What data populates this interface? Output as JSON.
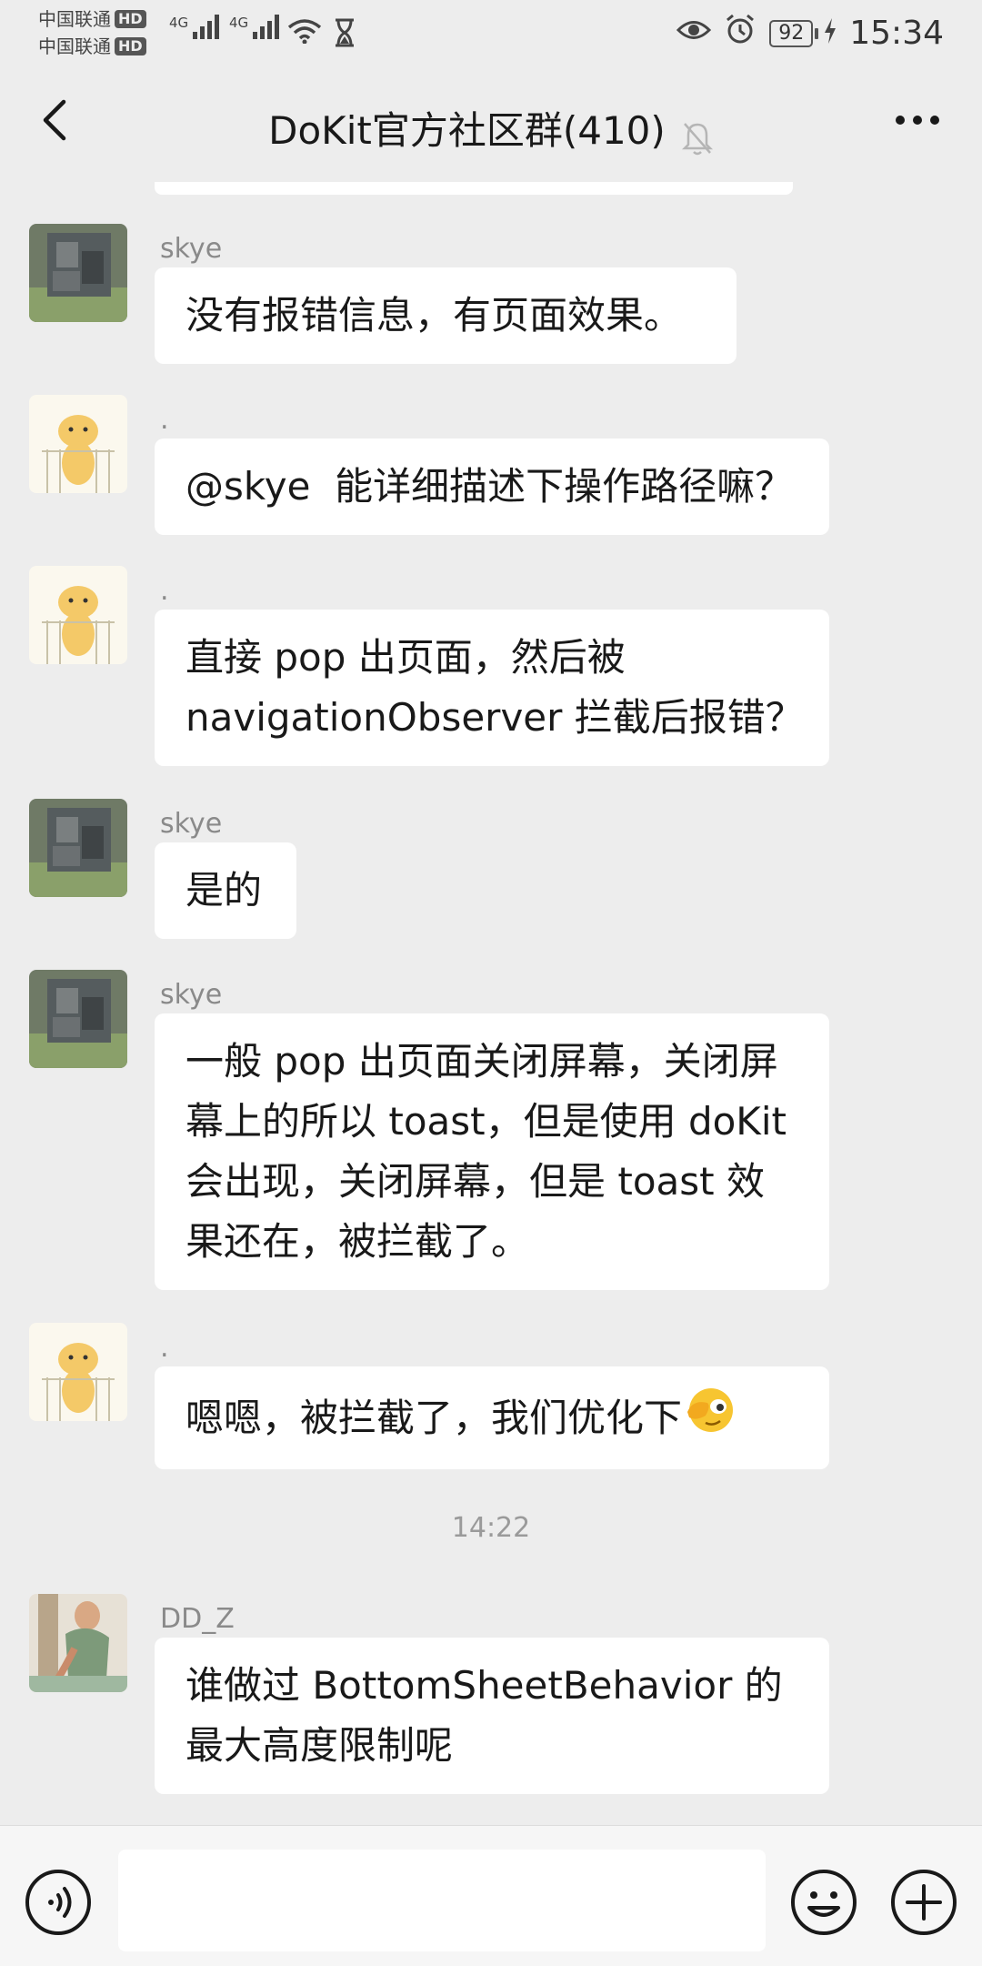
{
  "status_bar": {
    "carrier_1": "中国联通",
    "carrier_2": "中国联通",
    "hd_badge": "HD",
    "network_1": "4G",
    "network_2": "4G",
    "battery": "92",
    "time": "15:34"
  },
  "header": {
    "title": "DoKit官方社区群(410)"
  },
  "messages": [
    {
      "sender": "skye",
      "text": "没有报错信息，有页面效果。"
    },
    {
      "sender": ".",
      "text": "@skye  能详细描述下操作路径嘛？"
    },
    {
      "sender": ".",
      "text": "直接 pop 出页面，然后被\nnavigationObserver 拦截后报错？"
    },
    {
      "sender": "skye",
      "text": "是的"
    },
    {
      "sender": "skye",
      "text": "一般 pop 出页面关闭屏幕，关闭屏幕上的所以 toast，但是使用 doKit 会出现，关闭屏幕，但是 toast 效果还在，被拦截了。"
    },
    {
      "sender": ".",
      "text": "嗯嗯，被拦截了，我们优化下"
    },
    {
      "sender": "DD_Z",
      "text": "谁做过 BottomSheetBehavior 的最大高度限制呢"
    }
  ],
  "time_separator": "14:22",
  "input": {
    "value": ""
  },
  "icons": {
    "back": "back-arrow-icon",
    "mute": "bell-off-icon",
    "more": "more-dots-icon",
    "voice": "voice-icon",
    "emoji": "emoji-icon",
    "plus": "plus-icon",
    "facepalm_emoji": "facepalm-emoji-icon"
  },
  "colors": {
    "background": "#ededed",
    "bubble": "#ffffff",
    "input_bar": "#f6f6f6",
    "emoji_yellow": "#f7c531"
  }
}
